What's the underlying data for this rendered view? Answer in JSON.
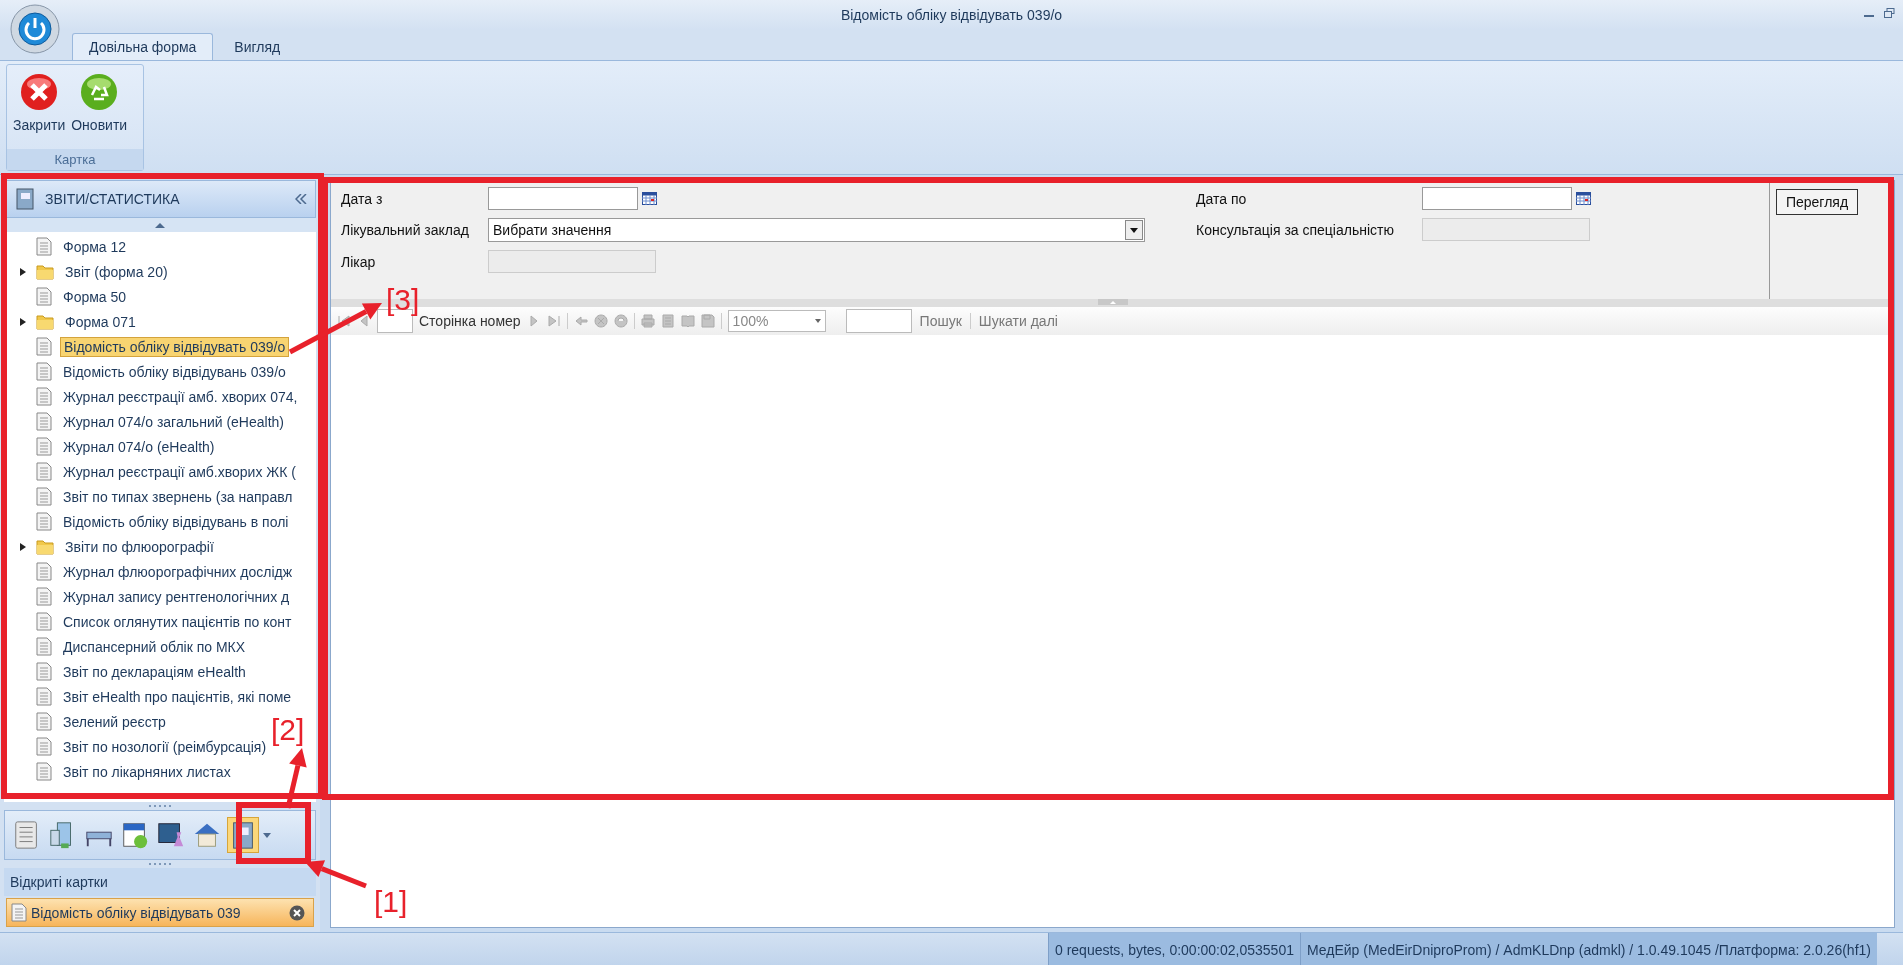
{
  "window": {
    "title": "Відомість обліку відвідувать 039/о"
  },
  "ribbon": {
    "tabs": [
      {
        "label": "Довільна форма",
        "selected": true
      },
      {
        "label": "Вигляд",
        "selected": false
      }
    ],
    "groups": [
      {
        "label": "Картка",
        "buttons": [
          {
            "label": "Закрити",
            "kind": "close"
          },
          {
            "label": "Оновити",
            "kind": "refresh"
          }
        ]
      }
    ]
  },
  "sidebar": {
    "title": "ЗВІТИ/СТАТИСТИКА",
    "tree": [
      {
        "label": "Форма 12",
        "kind": "doc",
        "selected": false
      },
      {
        "label": "Звіт (форма 20)",
        "kind": "folder",
        "expanded": false,
        "selected": false
      },
      {
        "label": "Форма 50",
        "kind": "doc",
        "selected": false
      },
      {
        "label": "Форма 071",
        "kind": "folder",
        "expanded": false,
        "selected": false
      },
      {
        "label": "Відомість обліку відвідувать 039/о",
        "kind": "doc",
        "selected": true
      },
      {
        "label": "Відомість обліку відвідувань 039/о",
        "kind": "doc",
        "selected": false
      },
      {
        "label": "Журнал реєстрації амб. хворих 074,",
        "kind": "doc",
        "selected": false
      },
      {
        "label": "Журнал 074/о загальний (eHealth)",
        "kind": "doc",
        "selected": false
      },
      {
        "label": "Журнал 074/о (eHealth)",
        "kind": "doc",
        "selected": false
      },
      {
        "label": "Журнал реєстрації амб.хворих ЖК (",
        "kind": "doc",
        "selected": false
      },
      {
        "label": "Звіт по типах звернень (за направл",
        "kind": "doc",
        "selected": false
      },
      {
        "label": "Відомість обліку відвідувань в полі",
        "kind": "doc",
        "selected": false
      },
      {
        "label": "Звіти по флюорографії",
        "kind": "folder",
        "expanded": false,
        "selected": false
      },
      {
        "label": "Журнал флюорографічних дослідж",
        "kind": "doc",
        "selected": false
      },
      {
        "label": "Журнал запису рентгенологічних д",
        "kind": "doc",
        "selected": false
      },
      {
        "label": "Список оглянутих пацієнтів по конт",
        "kind": "doc",
        "selected": false
      },
      {
        "label": "Диспансерний облік по МКХ",
        "kind": "doc",
        "selected": false
      },
      {
        "label": "Звіт по деклараціям eHealth",
        "kind": "doc",
        "selected": false
      },
      {
        "label": "Звіт eHealth про пацієнтів, які поме",
        "kind": "doc",
        "selected": false
      },
      {
        "label": "Зелений реєстр",
        "kind": "doc",
        "selected": false
      },
      {
        "label": "Звіт по нозології (реімбурсація)",
        "kind": "doc",
        "selected": false
      },
      {
        "label": "Звіт по лікарняних листах",
        "kind": "doc",
        "selected": false
      }
    ],
    "nav_buttons": [
      {
        "kind": "list",
        "selected": false
      },
      {
        "kind": "building",
        "selected": false
      },
      {
        "kind": "bed",
        "selected": false
      },
      {
        "kind": "calendar",
        "selected": false
      },
      {
        "kind": "lab",
        "selected": false
      },
      {
        "kind": "house",
        "selected": false
      },
      {
        "kind": "book",
        "selected": true
      }
    ],
    "open_cards": {
      "title": "Відкриті картки",
      "cards": [
        {
          "label": "Відомість обліку відвідувать 039",
          "selected": true
        }
      ]
    }
  },
  "form": {
    "left_fields": [
      {
        "label": "Дата з",
        "kind": "date",
        "disabled": false
      },
      {
        "label": "Лікувальний заклад",
        "kind": "select",
        "value": "Вибрати значення",
        "disabled": false
      },
      {
        "label": "Лікар",
        "kind": "text",
        "disabled": true
      }
    ],
    "right_fields": [
      {
        "label": "Дата по",
        "kind": "date",
        "disabled": false
      },
      {
        "label": "Консультація за спеціальністю",
        "kind": "text",
        "disabled": true
      }
    ],
    "submit_button": "Перегляд"
  },
  "toolbar": {
    "page_label": "Сторінка номер",
    "zoom": "100%",
    "search_button": "Пошук",
    "find_next_button": "Шукати далі"
  },
  "status_bar": [
    "0 requests,  bytes, 0:00:00:02,0535501",
    "МедЕйр (MedEirDniproProm) / AdmKLDnp (admkl) / 1.0.49.1045 /Платформа: 2.0.26(hf1)"
  ],
  "annotations": [
    {
      "label": "[1]"
    },
    {
      "label": "[2]"
    },
    {
      "label": "[3]"
    }
  ]
}
